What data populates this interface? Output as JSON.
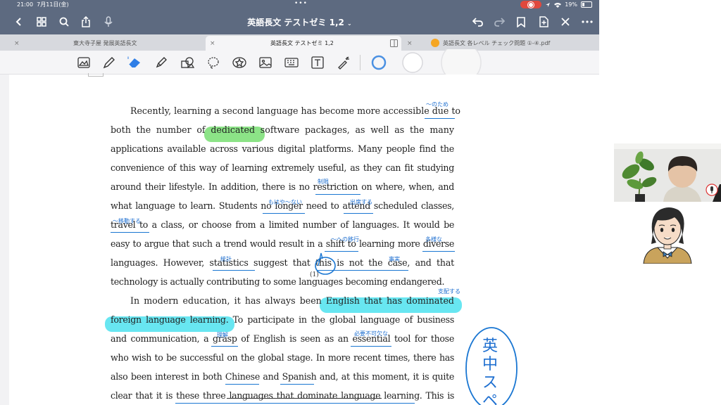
{
  "status": {
    "time": "21:00",
    "date": "7月11日(金)",
    "dots": "•••",
    "battery": "19%"
  },
  "nav": {
    "title": "英語長文 テストゼミ 1,2"
  },
  "tabs": [
    {
      "label": "東大寺子屋 発展英語長文"
    },
    {
      "label": "英語長文 テストゼミ 1,2"
    },
    {
      "label": "英語長文 各レベル チェック問題 ①-④.pdf"
    }
  ],
  "document": {
    "lines": [
      "Recently, learning a second language has become more accessible due to",
      "both the number of dedicated software packages, as well as the many",
      "applications available across various digital platforms.  Many people find the",
      "convenience of this way of learning extremely useful, as they can fit studying",
      "around their lifestyle.  In addition, there is no restriction on where, when, and",
      "what language to learn.  Students no longer need to attend scheduled classes,",
      "travel to a class, or choose from a limited number of languages.  It would be",
      "easy to argue that such a trend would result in a shift to learning more diverse",
      "languages.   However, statistics suggest that this is not the case, and that",
      "technology is actually contributing to some languages becoming endangered.",
      "In modern education, it has always been English that has dominated",
      "foreign language learning.  To participate in the global language of business",
      "and communication, a grasp of English is seen as an essential tool for those",
      "who wish to be successful on the global stage.  In more recent times, there has",
      "also been interest in both Chinese and Spanish and, at this moment, it is quite",
      "clear that it is these three languages that dominate language learning.  This is"
    ],
    "marker": "(1)"
  },
  "annotations": {
    "due_to": "〜のため",
    "restriction": "制限",
    "no_longer": "もはや〜ない",
    "attend": "出席する",
    "travel_to": "〜移動する",
    "shift_to": "〜への移行",
    "diverse": "多様な",
    "statistics": "統計",
    "case": "事実",
    "dominated": "支配する",
    "grasp": "理解",
    "essential": "必要不可欠な",
    "margin_note": "英中スペ"
  },
  "colors": {
    "nav_bg": "#5d6a80",
    "highlight_green": "#7fe07a",
    "highlight_cyan": "#58e3f0",
    "ink_blue": "#1976d2"
  }
}
